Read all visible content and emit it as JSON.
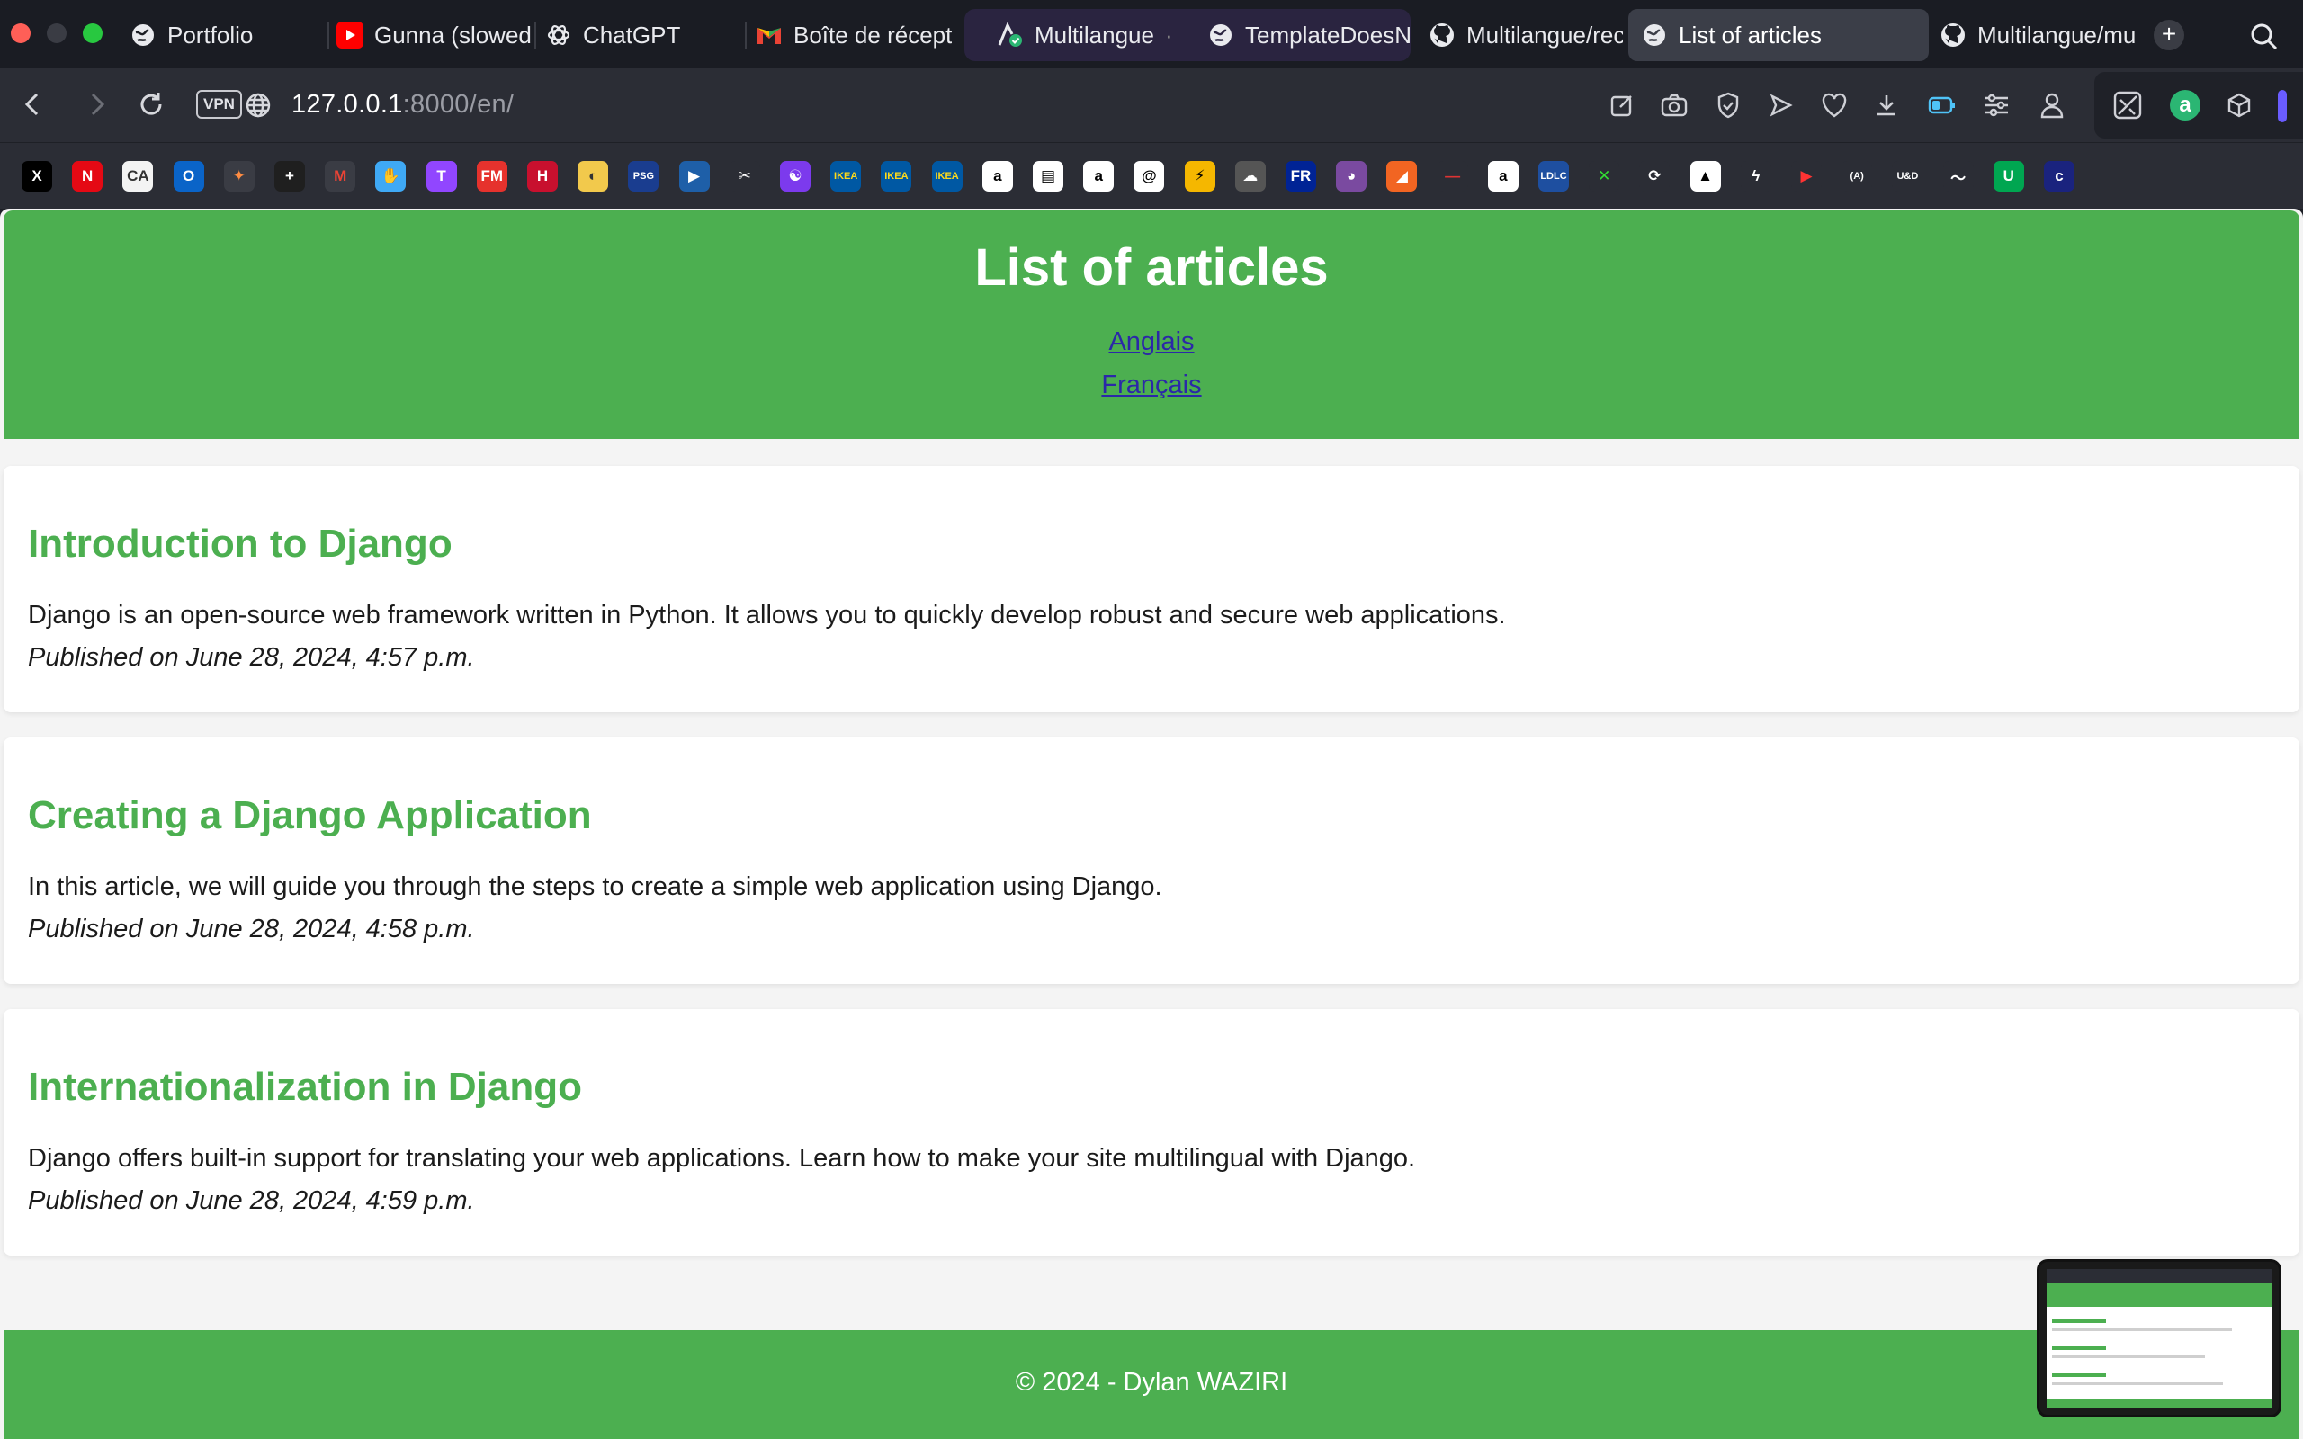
{
  "browser": {
    "tabs": [
      {
        "label": "Portfolio",
        "icon": "globe-icon"
      },
      {
        "label": "Gunna (slowed",
        "icon": "youtube-icon"
      },
      {
        "label": "ChatGPT",
        "icon": "chatgpt-icon"
      },
      {
        "label": "Boîte de récept",
        "icon": "gmail-icon"
      },
      {
        "label": "Multilangue",
        "icon": "tab-group-icon"
      },
      {
        "label": "TemplateDoesN",
        "icon": "globe-icon"
      },
      {
        "label": "Multilangue/rec",
        "icon": "github-icon"
      },
      {
        "label": "List of articles",
        "icon": "globe-icon"
      },
      {
        "label": "Multilangue/mu",
        "icon": "github-icon"
      }
    ],
    "tab_group_dot": "·",
    "new_tab_label": "+",
    "vpn_label": "VPN",
    "url_host": "127.0.0.1",
    "url_rest": ":8000/en/",
    "bookmarks": [
      "X",
      "N",
      "CA",
      "O",
      "✦",
      "+",
      "M",
      "✋",
      "T",
      "FM",
      "H",
      "◐",
      "PSG",
      "▶",
      "✂",
      "☯",
      "IKEA",
      "IKEA",
      "IKEA",
      "a",
      "▤",
      "a",
      "@",
      "⚡",
      "☁",
      "FR",
      "◕",
      "◢",
      "—",
      "a",
      "LDLC",
      "✕",
      "⟳",
      "▲",
      "ϟ",
      "▶",
      "(A)",
      "U&D",
      "〜",
      "U",
      "c"
    ]
  },
  "page": {
    "title": "List of articles",
    "languages": [
      "Anglais",
      "Français"
    ],
    "articles": [
      {
        "title": "Introduction to Django",
        "summary": "Django is an open-source web framework written in Python. It allows you to quickly develop robust and secure web applications.",
        "published": "Published on June 28, 2024, 4:57 p.m."
      },
      {
        "title": "Creating a Django Application",
        "summary": "In this article, we will guide you through the steps to create a simple web application using Django.",
        "published": "Published on June 28, 2024, 4:58 p.m."
      },
      {
        "title": "Internationalization in Django",
        "summary": "Django offers built-in support for translating your web applications. Learn how to make your site multilingual with Django.",
        "published": "Published on June 28, 2024, 4:59 p.m."
      }
    ],
    "footer": "© 2024 - Dylan WAZIRI"
  },
  "colors": {
    "brand_green": "#4caf50",
    "link": "#2b28a8",
    "browser_bg": "#1a1c23"
  }
}
